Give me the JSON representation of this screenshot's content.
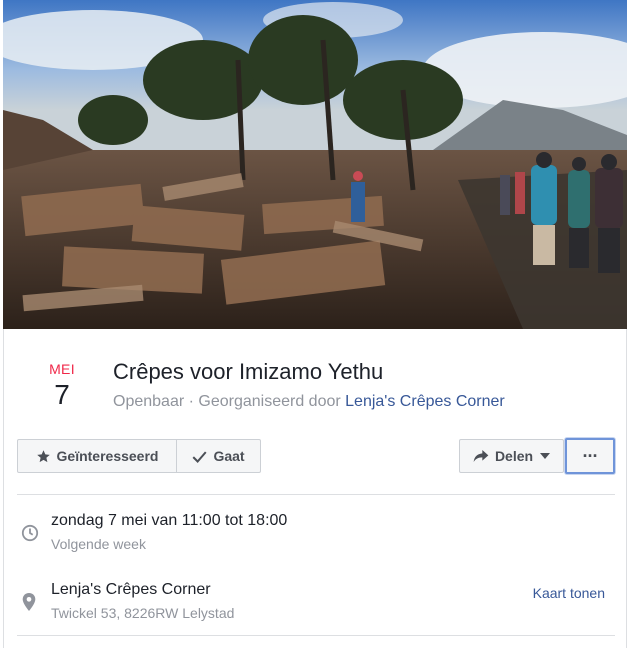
{
  "event": {
    "month": "MEI",
    "day": "7",
    "title": "Crêpes voor Imizamo Yethu",
    "privacy": "Openbaar",
    "organized_by_label": " · Georganiseerd door ",
    "organizer": "Lenja's Crêpes Corner"
  },
  "actions": {
    "interested_label": "Geïnteresseerd",
    "going_label": "Gaat",
    "share_label": "Delen",
    "more_label": "···"
  },
  "time": {
    "main": "zondag 7 mei van 11:00 tot 18:00",
    "sub": "Volgende week"
  },
  "location": {
    "name": "Lenja's Crêpes Corner",
    "address": "Twickel 53, 8226RW Lelystad",
    "map_link": "Kaart tonen"
  },
  "icons": {
    "interested": "star-icon",
    "going": "checkmark-icon",
    "share": "share-arrow-icon",
    "share_caret": "chevron-down-icon",
    "time": "clock-icon",
    "location": "map-pin-icon"
  },
  "colors": {
    "month": "#f02849",
    "link": "#385898",
    "muted": "#90949c",
    "focus_ring": "#6f94d9"
  }
}
